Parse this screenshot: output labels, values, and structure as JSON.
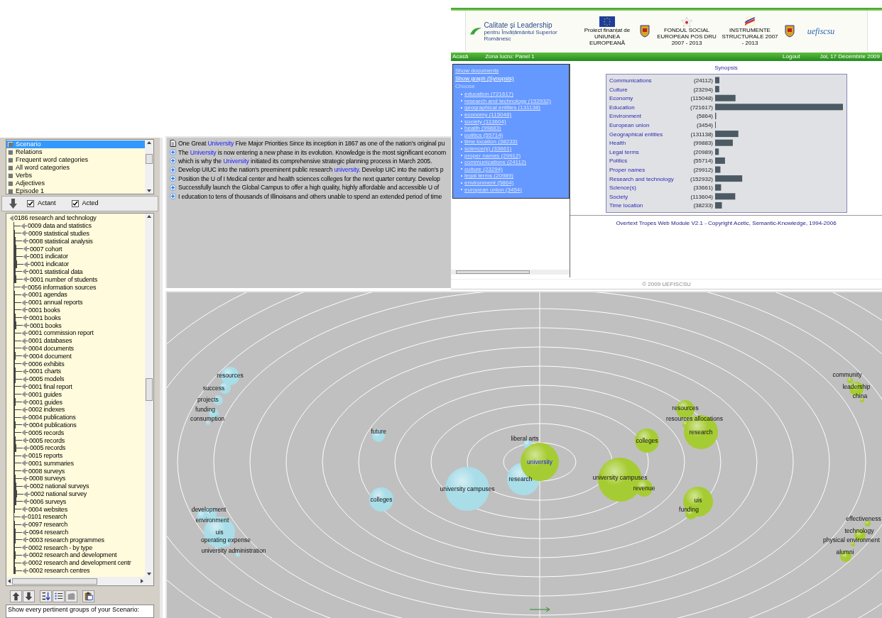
{
  "left_panel": {
    "views": [
      {
        "label": "Scenario",
        "selected": true
      },
      {
        "label": "Relations",
        "selected": false
      },
      {
        "label": "Frequent word categories",
        "selected": false
      },
      {
        "label": "All word categories",
        "selected": false
      },
      {
        "label": "Verbs",
        "selected": false
      },
      {
        "label": "Adjectives",
        "selected": false
      },
      {
        "label": "Episode 1",
        "selected": false
      }
    ],
    "filters": [
      {
        "label": "Actant",
        "checked": true
      },
      {
        "label": "Acted",
        "checked": true
      }
    ],
    "tree": {
      "label": "0186 research and technology",
      "children": [
        {
          "label": "0009 data and statistics",
          "children": [
            {
              "label": "0009 statistical studies",
              "children": [
                {
                  "label": "0008 statistical analysis",
                  "children": [
                    {
                      "label": "0007 cohort"
                    },
                    {
                      "label": "0001 indicator",
                      "children": [
                        {
                          "label": "0001 indicator"
                        }
                      ]
                    }
                  ]
                },
                {
                  "label": "0001 statistical data",
                  "children": [
                    {
                      "label": "0001 number of students"
                    }
                  ]
                }
              ]
            }
          ]
        },
        {
          "label": "0056 information sources",
          "children": [
            {
              "label": "0001 agendas"
            },
            {
              "label": "0001 annual reports"
            },
            {
              "label": "0001 books",
              "children": [
                {
                  "label": "0001 books",
                  "children": [
                    {
                      "label": "0001 books"
                    }
                  ]
                }
              ]
            },
            {
              "label": "0001 commission report"
            },
            {
              "label": "0001 databases"
            },
            {
              "label": "0004 documents",
              "children": [
                {
                  "label": "0004 document"
                }
              ]
            },
            {
              "label": "0006 exhibits",
              "children": [
                {
                  "label": "0001 charts"
                },
                {
                  "label": "0005 models"
                }
              ]
            },
            {
              "label": "0001 final report"
            },
            {
              "label": "0001 guides",
              "children": [
                {
                  "label": "0001 guides"
                }
              ]
            },
            {
              "label": "0002 indexes"
            },
            {
              "label": "0004 publications",
              "children": [
                {
                  "label": "0004 publications"
                }
              ]
            },
            {
              "label": "0005 records",
              "children": [
                {
                  "label": "0005 records",
                  "children": [
                    {
                      "label": "0005 records"
                    }
                  ]
                }
              ]
            },
            {
              "label": "0015 reports"
            },
            {
              "label": "0001 summaries"
            },
            {
              "label": "0008 surveys",
              "children": [
                {
                  "label": "0008 surveys",
                  "children": [
                    {
                      "label": "0002 national surveys",
                      "children": [
                        {
                          "label": "0002 national survey"
                        }
                      ]
                    },
                    {
                      "label": "0006 surveys"
                    }
                  ]
                }
              ]
            },
            {
              "label": "0004 websites"
            }
          ]
        },
        {
          "label": "0101 research",
          "children": [
            {
              "label": "0097 research",
              "children": [
                {
                  "label": "0094 research"
                },
                {
                  "label": "0003 research programmes"
                }
              ]
            },
            {
              "label": "0002 research - by type",
              "children": [
                {
                  "label": "0002 research and development"
                }
              ]
            },
            {
              "label": "0002 research and development centr",
              "children": [
                {
                  "label": "0002 research centres"
                }
              ]
            }
          ]
        }
      ]
    },
    "status_text": "Show every pertinent groups of your Scenario:"
  },
  "text_pane": {
    "lines": [
      {
        "kind": "document",
        "text_before": "One Great ",
        "keyword": "University",
        "text_after": " Five Major Priorities Since its inception in 1867 as one of the nation's original pu"
      },
      {
        "kind": "expand",
        "text_before": "The ",
        "keyword": "University",
        "text_after": " is now entering a new phase in its evolution. Knowledge is the most significant econom"
      },
      {
        "kind": "expand",
        "text_before": " which is why the ",
        "keyword": "University",
        "text_after": " initiated its comprehensive strategic planning process in March 2005."
      },
      {
        "kind": "expand",
        "text_before": "Develop UIUC into the nation's preeminent public research ",
        "keyword": "university",
        "text_after": ". Develop UIC into the nation's p"
      },
      {
        "kind": "expand",
        "text_before": "Position the U of I Medical center and health sciences colleges for the next quarter century. Develop"
      },
      {
        "kind": "expand",
        "text_before": "Successfully launch the Global Campus to offer a high quality, highly affordable and accessible U of"
      },
      {
        "kind": "expand",
        "text_before": " I education to tens of thousands of Illinoisans and others unable to spend an extended period of time"
      }
    ]
  },
  "web_page": {
    "header": {
      "brand": "Calitate și Leadership",
      "brand_tagline": "pentru Învățământul Superior Românesc",
      "logo_captions": [
        "Proiect finanțat de UNIUNEA EUROPEANĂ",
        "FONDUL SOCIAL EUROPEAN POS DRU 2007 - 2013",
        "INSTRUMENTE STRUCTURALE 2007 - 2013"
      ],
      "uefiscsu_logo": "uefiscsu"
    },
    "nav": {
      "left": [
        "Acasă",
        "Zona lucru: Panel 1"
      ],
      "logout": "Logout",
      "date": "Joi, 17 Decembrie 2009"
    },
    "sidebar": {
      "links": [
        "Show documents",
        "Show graph (Synopsis)"
      ],
      "heading": "Choose",
      "categories": [
        "education (721617)",
        "research and technology (152932)",
        "geographical entities (131138)",
        "economy (115048)",
        "society (113604)",
        "health (99883)",
        "politics (55714)",
        "time location (38233)",
        "science(s) (33661)",
        "proper names (29912)",
        "communications (24112)",
        "culture (23294)",
        "legal terms (20989)",
        "environment (5864)",
        "european union (3454)"
      ]
    },
    "chart_data": {
      "type": "bar",
      "orientation": "horizontal",
      "title": "Synopsis",
      "categories": [
        "Communications",
        "Culture",
        "Economy",
        "Education",
        "Environment",
        "European union",
        "Geographical entities",
        "Health",
        "Legal terms",
        "Politics",
        "Proper names",
        "Research and technology",
        "Science(s)",
        "Society",
        "Time location"
      ],
      "values": [
        24112,
        23294,
        115048,
        721617,
        5864,
        3454,
        131138,
        99883,
        20989,
        55714,
        29912,
        152932,
        33661,
        113604,
        38233
      ],
      "value_labels": [
        "(24112)",
        "(23294)",
        "(115048)",
        "(721617)",
        "(5864)",
        "(3454)",
        "(131138)",
        "(99883)",
        "(20989)",
        "(55714)",
        "(29912)",
        "(152932)",
        "(33661)",
        "(113604)",
        "(38233)"
      ]
    },
    "copyright": "Overtext Tropes Web Module V2.1 - Copyright Acetic, Semantic-Knowledge, 1994-2006",
    "footer": "© 2009 UEFISCSU"
  },
  "bubble_chart": {
    "bubbles": [
      {
        "label": "resources",
        "color": "#a9dde8",
        "highlighted": false
      },
      {
        "label": "success",
        "color": "#a9dde8",
        "highlighted": false
      },
      {
        "label": "projects",
        "color": "#a9dde8",
        "highlighted": false
      },
      {
        "label": "funding",
        "color": "#a9dde8",
        "highlighted": false
      },
      {
        "label": "consumption",
        "color": "#a9dde8",
        "highlighted": false
      },
      {
        "label": "future",
        "color": "#a9dde8",
        "highlighted": false
      },
      {
        "label": "colleges",
        "color": "#a9dde8",
        "highlighted": false
      },
      {
        "label": "university campuses",
        "color": "#a9dde8",
        "highlighted": false
      },
      {
        "label": "research",
        "color": "#a9dde8",
        "highlighted": false
      },
      {
        "label": "liberal arts",
        "color": "#a9dde8",
        "highlighted": false
      },
      {
        "label": "development",
        "color": "#a9dde8",
        "highlighted": false
      },
      {
        "label": "environment",
        "color": "#a9dde8",
        "highlighted": false
      },
      {
        "label": "uis",
        "color": "#a9dde8",
        "highlighted": false
      },
      {
        "label": "operating expense",
        "color": "#a9dde8",
        "highlighted": false
      },
      {
        "label": "university administration",
        "color": "#a9dde8",
        "highlighted": false
      },
      {
        "label": "university",
        "color": "#a6cc33",
        "highlighted": true
      },
      {
        "label": "university campuses",
        "color": "#a6cc33",
        "highlighted": false
      },
      {
        "label": "colleges",
        "color": "#a6cc33",
        "highlighted": false
      },
      {
        "label": "revenue",
        "color": "#a6cc33",
        "highlighted": false
      },
      {
        "label": "resources",
        "color": "#a6cc33",
        "highlighted": false
      },
      {
        "label": "resources allocations",
        "color": "#a6cc33",
        "highlighted": false
      },
      {
        "label": "research",
        "color": "#a6cc33",
        "highlighted": false
      },
      {
        "label": "uis",
        "color": "#a6cc33",
        "highlighted": false
      },
      {
        "label": "funding",
        "color": "#a6cc33",
        "highlighted": false
      },
      {
        "label": "community",
        "color": "#a6cc33",
        "highlighted": false
      },
      {
        "label": "leadership",
        "color": "#a6cc33",
        "highlighted": false
      },
      {
        "label": "china",
        "color": "#a6cc33",
        "highlighted": false
      },
      {
        "label": "effectiveness",
        "color": "#a6cc33",
        "highlighted": false
      },
      {
        "label": "technology",
        "color": "#a6cc33",
        "highlighted": false
      },
      {
        "label": "physical environment",
        "color": "#a6cc33",
        "highlighted": false
      },
      {
        "label": "alumni",
        "color": "#a6cc33",
        "highlighted": false
      }
    ]
  }
}
